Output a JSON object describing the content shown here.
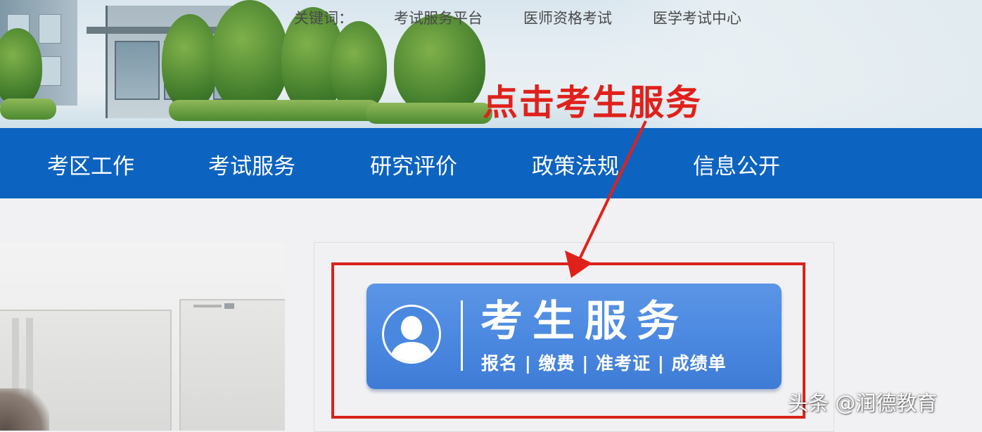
{
  "header": {
    "keywords_label": "关键词：",
    "keyword_links": [
      "考试服务平台",
      "医师资格考试",
      "医学考试中心"
    ]
  },
  "annotation": {
    "text": "点击考生服务",
    "color": "#e0211b"
  },
  "nav": {
    "items": [
      "考区工作",
      "考试服务",
      "研究评价",
      "政策法规",
      "信息公开"
    ],
    "background": "#0d63c0"
  },
  "service_button": {
    "title": "考生服务",
    "subtitle": "报名 | 缴费 | 准考证 | 成绩单",
    "icon": "user-avatar-icon",
    "color": "#4a88e0"
  },
  "watermark": "头条 @润德教育"
}
